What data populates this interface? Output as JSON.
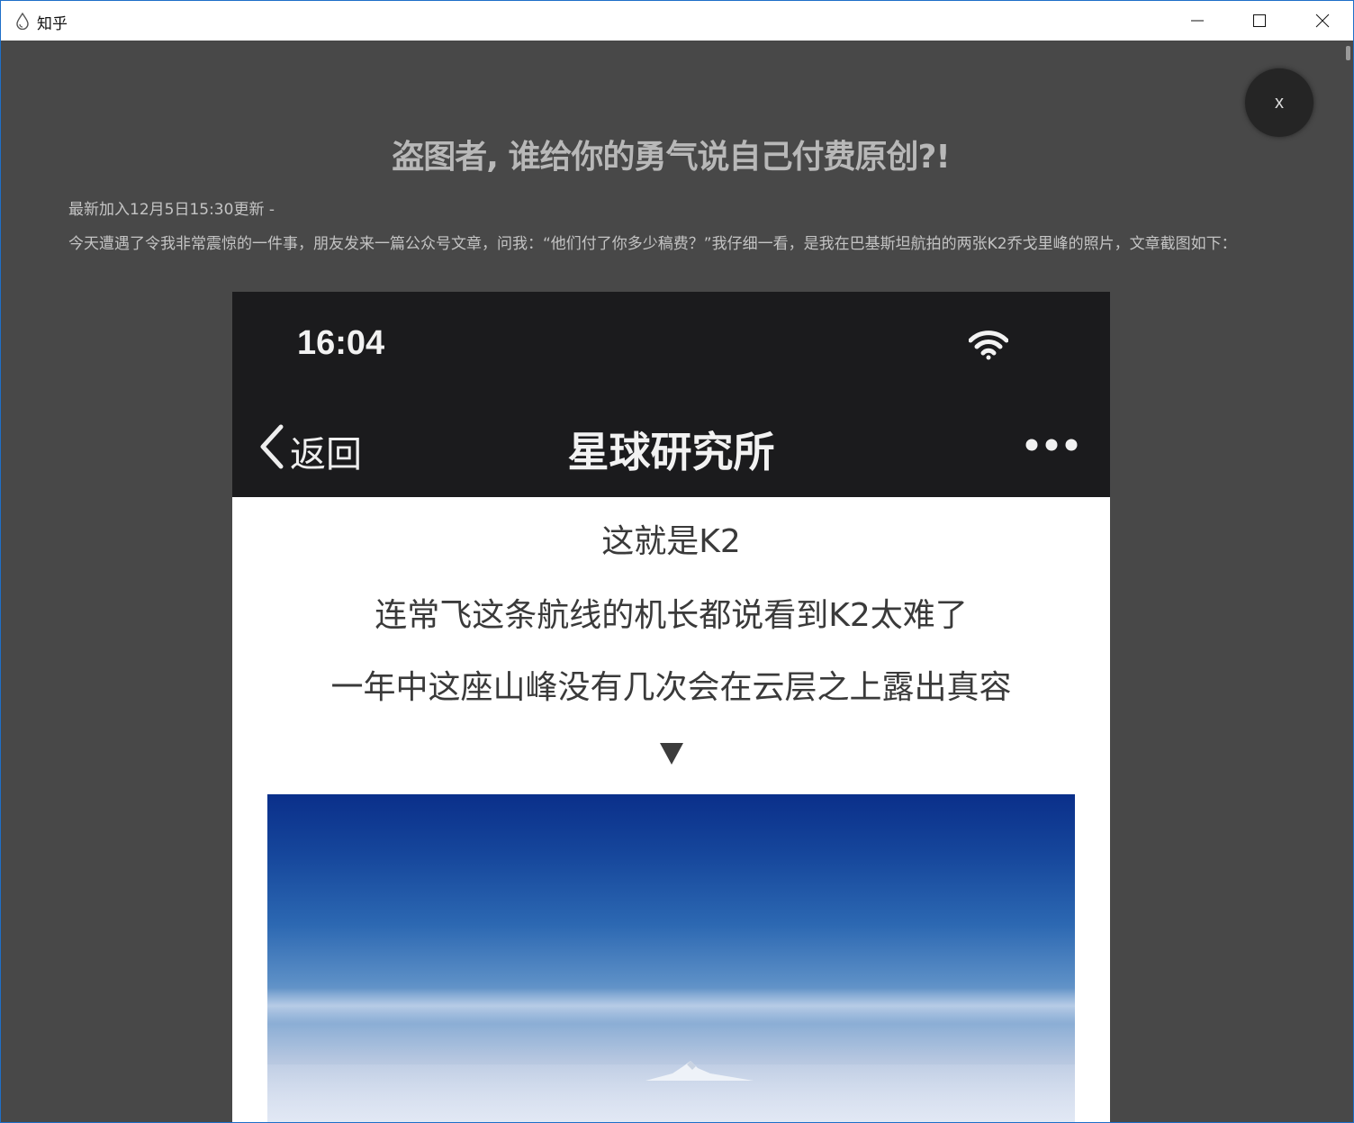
{
  "window": {
    "title": "知乎",
    "icon": "zhihu-drop-icon",
    "controls": [
      "minimize-icon",
      "maximize-icon",
      "close-icon"
    ]
  },
  "viewer": {
    "close_label": "x"
  },
  "article": {
    "title": "盗图者, 谁给你的勇气说自己付费原创?!",
    "update_note": "最新加入12月5日15:30更新 -",
    "intro": "今天遭遇了令我非常震惊的一件事，朋友发来一篇公众号文章，问我：“他们付了你多少稿费？”我仔细一看，是我在巴基斯坦航拍的两张K2乔戈里峰的照片，文章截图如下："
  },
  "screenshot": {
    "status_time": "16:04",
    "back_label": "返回",
    "nav_title": "星球研究所",
    "lines": [
      "这就是K2",
      "连常飞这条航线的机长都说看到K2太难了",
      "一年中这座山峰没有几次会在云层之上露出真容"
    ],
    "arrow": "▼"
  },
  "colors": {
    "background": "#484848",
    "titlebar": "#ffffff",
    "accent_border": "#1e6fc8",
    "phone_bar": "#1b1b1d"
  }
}
